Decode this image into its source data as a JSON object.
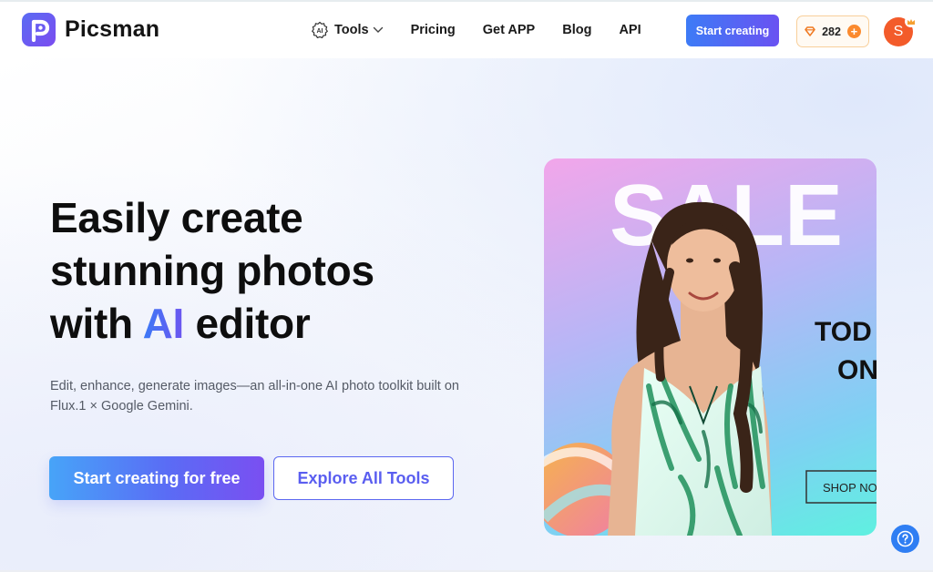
{
  "app": {
    "name": "Picsman",
    "logo_letter": "P"
  },
  "header": {
    "nav": {
      "tools_label": "Tools",
      "tools_badge": "AI",
      "pricing_label": "Pricing",
      "get_app_label": "Get APP",
      "blog_label": "Blog",
      "api_label": "API"
    },
    "start_button_label": "Start creating",
    "credits": {
      "count": "282",
      "plus": "+"
    },
    "avatar_letter": "S"
  },
  "hero": {
    "title_line1": "Easily create",
    "title_line2": "stunning photos",
    "title_line3_prefix": "with ",
    "title_line3_highlight": "AI",
    "title_line3_suffix": " editor",
    "subtitle": "Edit, enhance, generate images—an all-in-one AI photo toolkit built on Flux.1 × Google Gemini.",
    "cta_primary": "Start creating for free",
    "cta_secondary": "Explore All Tools"
  },
  "promo": {
    "big_text": "SALE",
    "text_line1": "TOD",
    "text_line2": "ON",
    "shop_button": "SHOP NO"
  },
  "help": {
    "icon": "question-icon"
  },
  "colors": {
    "accent_blue": "#3d7bf6",
    "accent_purple": "#6a52f2",
    "credit_orange": "#fb8a2e",
    "avatar_orange": "#f35b2a"
  }
}
